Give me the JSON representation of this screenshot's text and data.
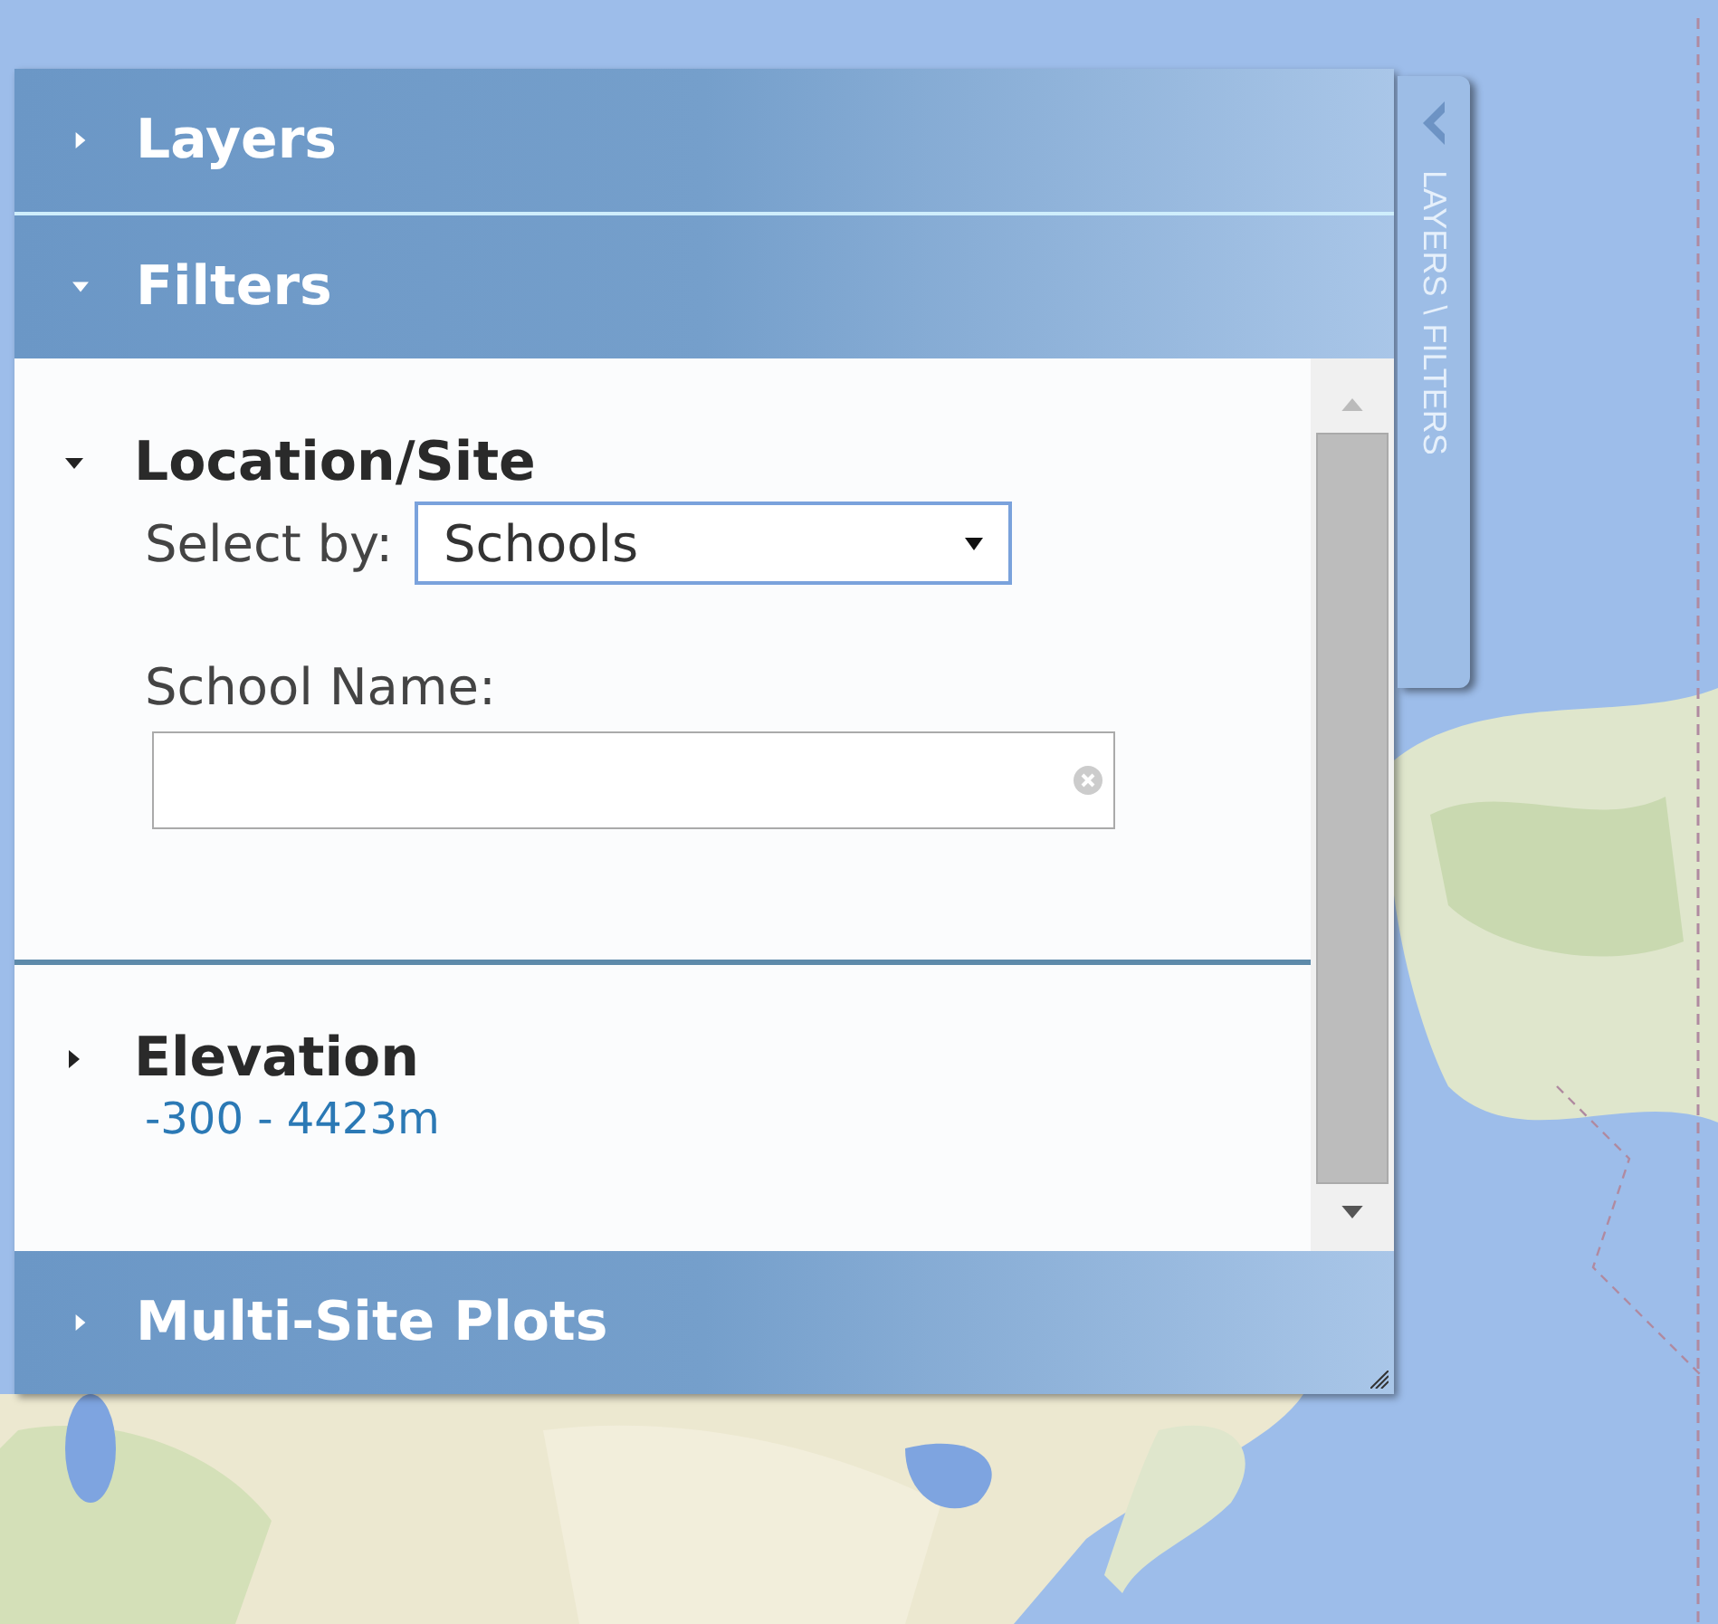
{
  "side_tab": {
    "label": "LAYERS \\ FILTERS"
  },
  "sections": [
    {
      "title": "Layers",
      "expanded": false
    },
    {
      "title": "Filters",
      "expanded": true,
      "groups": [
        {
          "kind": "location",
          "title": "Location/Site",
          "expanded": true,
          "select_label": "Select by:",
          "select_value": "Schools",
          "field_label": "School Name:"
        },
        {
          "kind": "range",
          "title": "Elevation",
          "expanded": false,
          "range": "-300 - 4423m"
        }
      ]
    },
    {
      "title": "Multi-Site Plots",
      "expanded": false
    }
  ]
}
